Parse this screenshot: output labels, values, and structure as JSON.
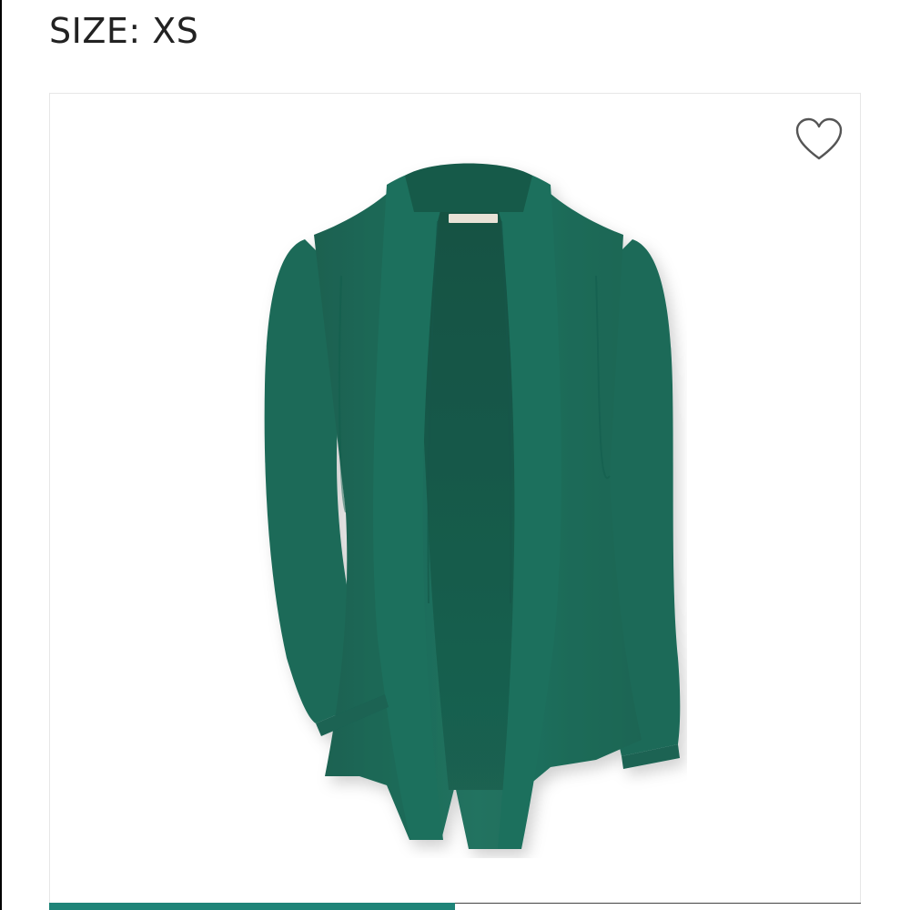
{
  "header": {
    "size_label": "SIZE: XS"
  },
  "product": {
    "image": {
      "description_icon": "green-open-front-cardigan",
      "primary_color": "#1f6e5c"
    },
    "favorite": {
      "icon": "heart-outline-icon"
    }
  },
  "gallery": {
    "progress": 0.5,
    "accent_color": "#1f8478"
  }
}
